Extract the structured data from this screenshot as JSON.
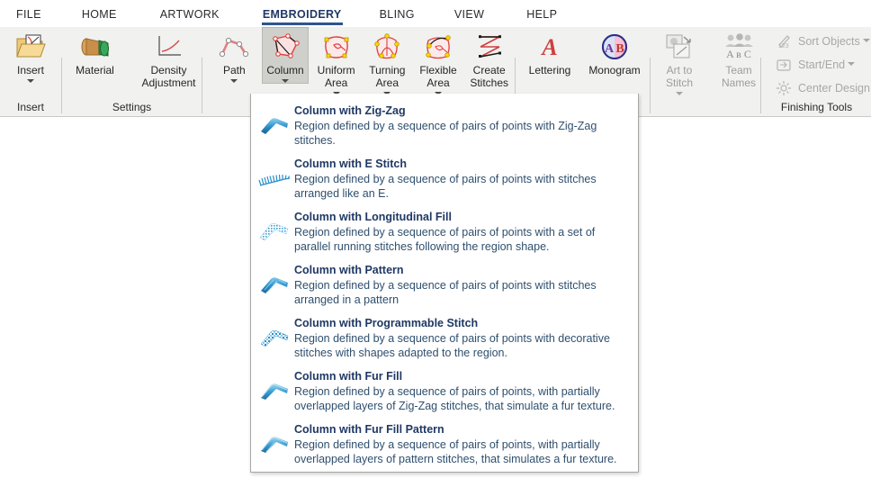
{
  "tabs": [
    {
      "label": "FILE",
      "active": false
    },
    {
      "label": "HOME",
      "active": false
    },
    {
      "label": "ARTWORK",
      "active": false
    },
    {
      "label": "EMBROIDERY",
      "active": true
    },
    {
      "label": "BLING",
      "active": false
    },
    {
      "label": "VIEW",
      "active": false
    },
    {
      "label": "HELP",
      "active": false
    }
  ],
  "ribbon": {
    "groups": [
      {
        "title": "Insert",
        "buttons": [
          {
            "label": "Insert",
            "icon": "insert-folder-icon",
            "has_caret": true,
            "active": false,
            "disabled": false
          }
        ]
      },
      {
        "title": "Settings",
        "buttons": [
          {
            "label": "Material",
            "icon": "material-thread-spool-icon",
            "has_caret": false,
            "active": false,
            "disabled": false
          },
          {
            "label": "Density\nAdjustment",
            "icon": "density-curve-icon",
            "has_caret": false,
            "active": false,
            "disabled": false
          }
        ]
      },
      {
        "title": "",
        "buttons": [
          {
            "label": "Path",
            "icon": "path-icon",
            "has_caret": true,
            "active": false,
            "disabled": false
          },
          {
            "label": "Column",
            "icon": "column-icon",
            "has_caret": true,
            "active": true,
            "disabled": false
          },
          {
            "label": "Uniform\nArea",
            "icon": "uniform-area-icon",
            "has_caret": true,
            "active": false,
            "disabled": false
          },
          {
            "label": "Turning\nArea",
            "icon": "turning-area-icon",
            "has_caret": true,
            "active": false,
            "disabled": false
          },
          {
            "label": "Flexible\nArea",
            "icon": "flexible-area-icon",
            "has_caret": true,
            "active": false,
            "disabled": false
          },
          {
            "label": "Create\nStitches",
            "icon": "create-stitches-icon",
            "has_caret": false,
            "active": false,
            "disabled": false
          }
        ]
      },
      {
        "title": "",
        "buttons": [
          {
            "label": "Lettering",
            "icon": "lettering-a-icon",
            "has_caret": false,
            "active": false,
            "disabled": false
          },
          {
            "label": "Monogram",
            "icon": "monogram-ab-icon",
            "has_caret": false,
            "active": false,
            "disabled": false
          }
        ]
      },
      {
        "title": "",
        "buttons": [
          {
            "label": "Art to\nStitch",
            "icon": "art-to-stitch-icon",
            "has_caret": true,
            "active": false,
            "disabled": true
          },
          {
            "label": "Team\nNames",
            "icon": "team-names-icon",
            "has_caret": false,
            "active": false,
            "disabled": true
          }
        ]
      },
      {
        "title": "Finishing Tools",
        "commands": [
          {
            "label": "Sort Objects",
            "icon": "sort-objects-icon",
            "has_caret": true,
            "disabled": true
          },
          {
            "label": "Start/End",
            "icon": "start-end-icon",
            "has_caret": true,
            "disabled": true
          },
          {
            "label": "Center Design",
            "icon": "center-design-icon",
            "has_caret": false,
            "disabled": true
          }
        ]
      }
    ]
  },
  "column_menu": {
    "items": [
      {
        "title": "Column with Zig-Zag",
        "desc": "Region defined by a sequence of pairs of points with  Zig-Zag stitches.",
        "icon": "column-zigzag-icon"
      },
      {
        "title": "Column with E Stitch",
        "desc": "Region defined by a sequence of pairs of points with stitches arranged like an E.",
        "icon": "column-e-stitch-icon"
      },
      {
        "title": "Column with Longitudinal Fill",
        "desc": "Region defined by a sequence of pairs of points with a set of parallel running stitches following the region shape.",
        "icon": "column-longitudinal-fill-icon"
      },
      {
        "title": "Column with Pattern",
        "desc": "Region defined by a sequence of pairs of points with stitches arranged in a pattern",
        "icon": "column-pattern-icon"
      },
      {
        "title": "Column with Programmable Stitch",
        "desc": "Region defined by a sequence of pairs of points with decorative stitches with shapes adapted to the region.",
        "icon": "column-programmable-stitch-icon"
      },
      {
        "title": "Column with Fur Fill",
        "desc": "Region defined by a sequence of pairs of points, with  partially overlapped layers of Zig-Zag stitches, that simulate a fur texture.",
        "icon": "column-fur-fill-icon"
      },
      {
        "title": "Column with Fur Fill Pattern",
        "desc": "Region defined by a sequence of pairs of points, with  partially overlapped layers of pattern stitches, that simulates a fur texture.",
        "icon": "column-fur-fill-pattern-icon"
      }
    ]
  },
  "colors": {
    "accent_blue": "#2e5490",
    "menu_title": "#1f3864",
    "menu_desc": "#2f4f6e",
    "ribbon_bg": "#f1f1ef",
    "active_btn": "#cfcfcb",
    "icon_blue": "#2e86c1",
    "icon_red": "#d94a4a"
  }
}
